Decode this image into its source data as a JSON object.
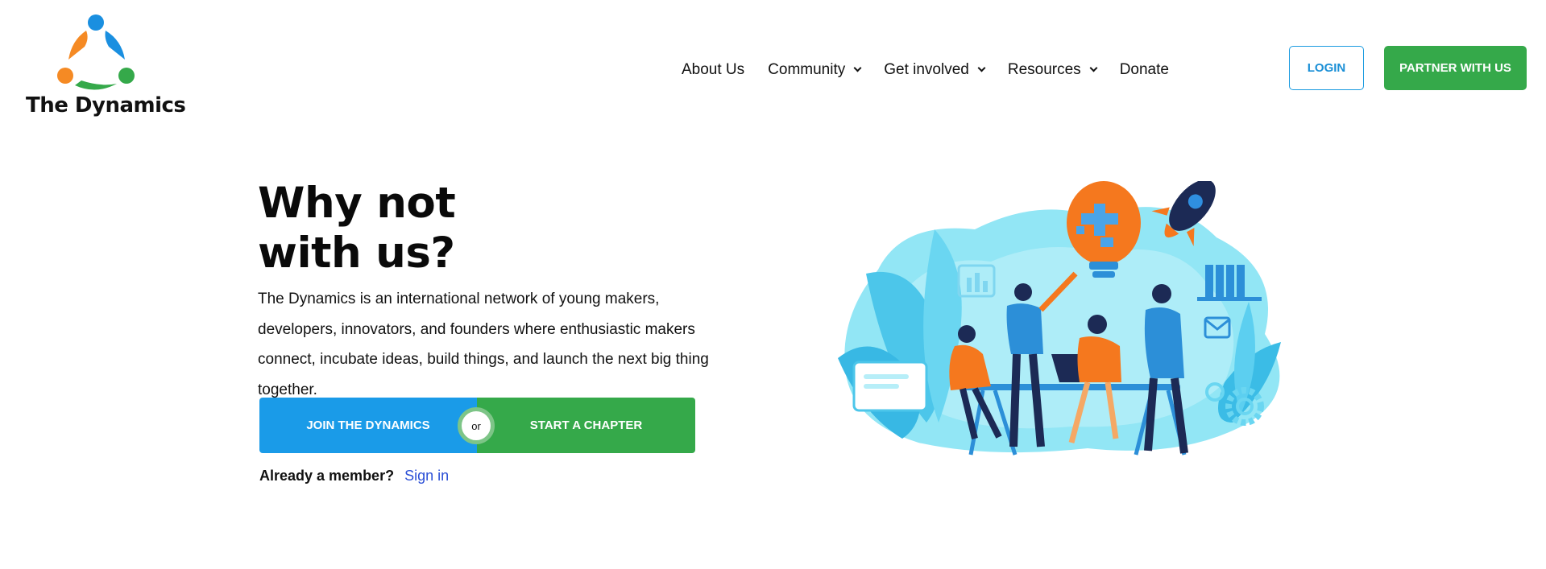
{
  "brand": {
    "name": "The Dynamics",
    "colors": {
      "blue": "#1a9be8",
      "orange": "#f58a24",
      "green": "#35a94a"
    }
  },
  "nav": {
    "items": [
      {
        "label": "About Us",
        "has_dropdown": false
      },
      {
        "label": "Community",
        "has_dropdown": true
      },
      {
        "label": "Get involved",
        "has_dropdown": true
      },
      {
        "label": "Resources",
        "has_dropdown": true
      },
      {
        "label": "Donate",
        "has_dropdown": false
      }
    ]
  },
  "header_actions": {
    "login_label": "LOGIN",
    "partner_label": "PARTNER WITH US"
  },
  "hero": {
    "title_line1": "Why not",
    "title_line2": "with us?",
    "description": "The Dynamics is an international network of young makers, developers, innovators, and founders where enthusiastic makers connect, incubate ideas, build things, and launch the next big thing together.",
    "join_label": "JOIN THE DYNAMICS",
    "or_label": "or",
    "chapter_label": "START A CHAPTER",
    "member_prompt": "Already a member?",
    "signin_label": "Sign in"
  },
  "illustration": {
    "icon": "team-brainstorm-illustration"
  }
}
